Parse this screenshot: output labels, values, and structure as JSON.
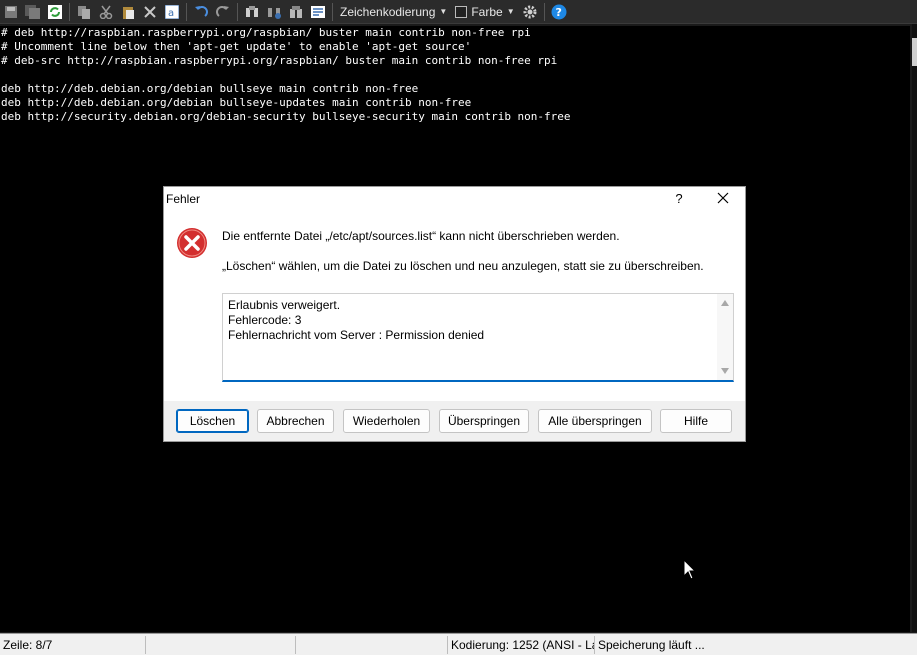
{
  "toolbar": {
    "encoding_label": "Zeichenkodierung",
    "color_label": "Farbe",
    "icons": [
      "save-icon",
      "save-all-icon",
      "refresh-icon",
      "copy-icon",
      "cut-icon",
      "paste-icon",
      "delete-icon",
      "select-all-icon",
      "undo-icon",
      "redo-icon",
      "find-icon",
      "find-replace-icon",
      "compare-icon",
      "word-wrap-icon",
      "settings-icon",
      "help-icon"
    ]
  },
  "editor": {
    "lines": [
      "# deb http://raspbian.raspberrypi.org/raspbian/ buster main contrib non-free rpi",
      "# Uncomment line below then 'apt-get update' to enable 'apt-get source'",
      "# deb-src http://raspbian.raspberrypi.org/raspbian/ buster main contrib non-free rpi",
      "",
      "deb http://deb.debian.org/debian bullseye main contrib non-free",
      "deb http://deb.debian.org/debian bullseye-updates main contrib non-free",
      "deb http://security.debian.org/debian-security bullseye-security main contrib non-free"
    ]
  },
  "dialog": {
    "title": "Fehler",
    "help_glyph": "?",
    "message": "Die entfernte Datei „/etc/apt/sources.list“ kann nicht überschrieben werden.",
    "hint": "„Löschen“ wählen, um die Datei zu löschen und neu anzulegen, statt sie zu überschreiben.",
    "details": [
      "Erlaubnis verweigert.",
      "Fehlercode: 3",
      "Fehlernachricht vom Server : Permission denied"
    ],
    "buttons": {
      "delete": "Löschen",
      "cancel": "Abbrechen",
      "retry": "Wiederholen",
      "skip": "Überspringen",
      "skip_all": "Alle überspringen",
      "help": "Hilfe"
    }
  },
  "statusbar": {
    "line": "Zeile: 8/7",
    "encoding": "Kodierung: 1252  (ANSI - La",
    "saving": "Speicherung läuft ..."
  },
  "colors": {
    "accent": "#0067c0",
    "error_red": "#d32f2f",
    "help_blue": "#1e88e5"
  }
}
